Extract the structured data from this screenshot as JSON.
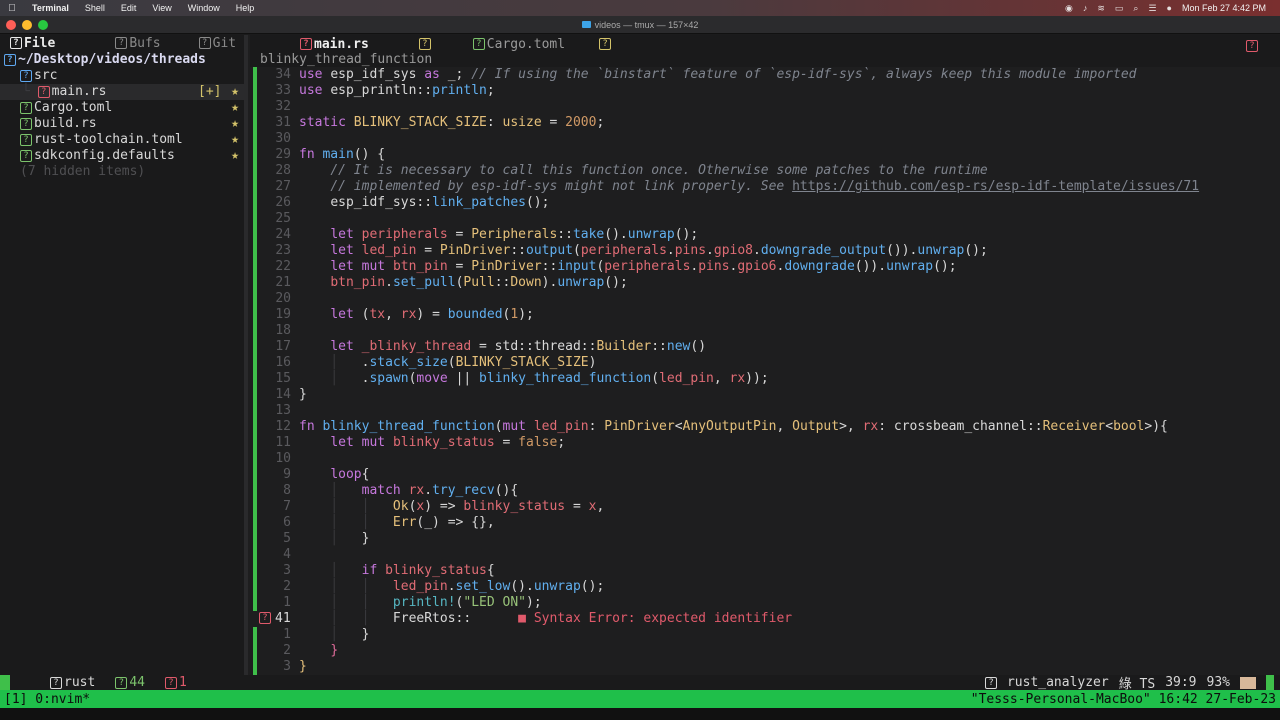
{
  "menubar": {
    "app": "Terminal",
    "items": [
      "Shell",
      "Edit",
      "View",
      "Window",
      "Help"
    ],
    "clock": "Mon Feb 27  4:42 PM"
  },
  "window": {
    "title": "videos — tmux — 157×42"
  },
  "sidebar": {
    "tabs": [
      "File",
      "Bufs",
      "Git"
    ],
    "root": "~/Desktop/videos/threads",
    "items": [
      {
        "label": "src",
        "mark": "",
        "star": ""
      },
      {
        "label": "main.rs",
        "mark": "[+]",
        "star": "★"
      },
      {
        "label": "Cargo.toml",
        "mark": "",
        "star": "★"
      },
      {
        "label": "build.rs",
        "mark": "",
        "star": "★"
      },
      {
        "label": "rust-toolchain.toml",
        "mark": "",
        "star": "★"
      },
      {
        "label": "sdkconfig.defaults",
        "mark": "",
        "star": "★"
      }
    ],
    "hidden": "(7 hidden items)"
  },
  "editor": {
    "tabs": [
      "main.rs",
      "Cargo.toml"
    ],
    "winbar": "blinky_thread_function",
    "diagnostic": "■ Syntax Error: expected identifier"
  },
  "status": {
    "filetype": "rust",
    "warnings": "44",
    "errors": "1",
    "lsp": "rust_analyzer",
    "ts": "綠 TS",
    "position": "39:9",
    "percent": "93%"
  },
  "tmux": {
    "left": "[1] 0:nvim*",
    "right": "\"Tesss-Personal-MacBoo\" 16:42 27-Feb-23"
  }
}
